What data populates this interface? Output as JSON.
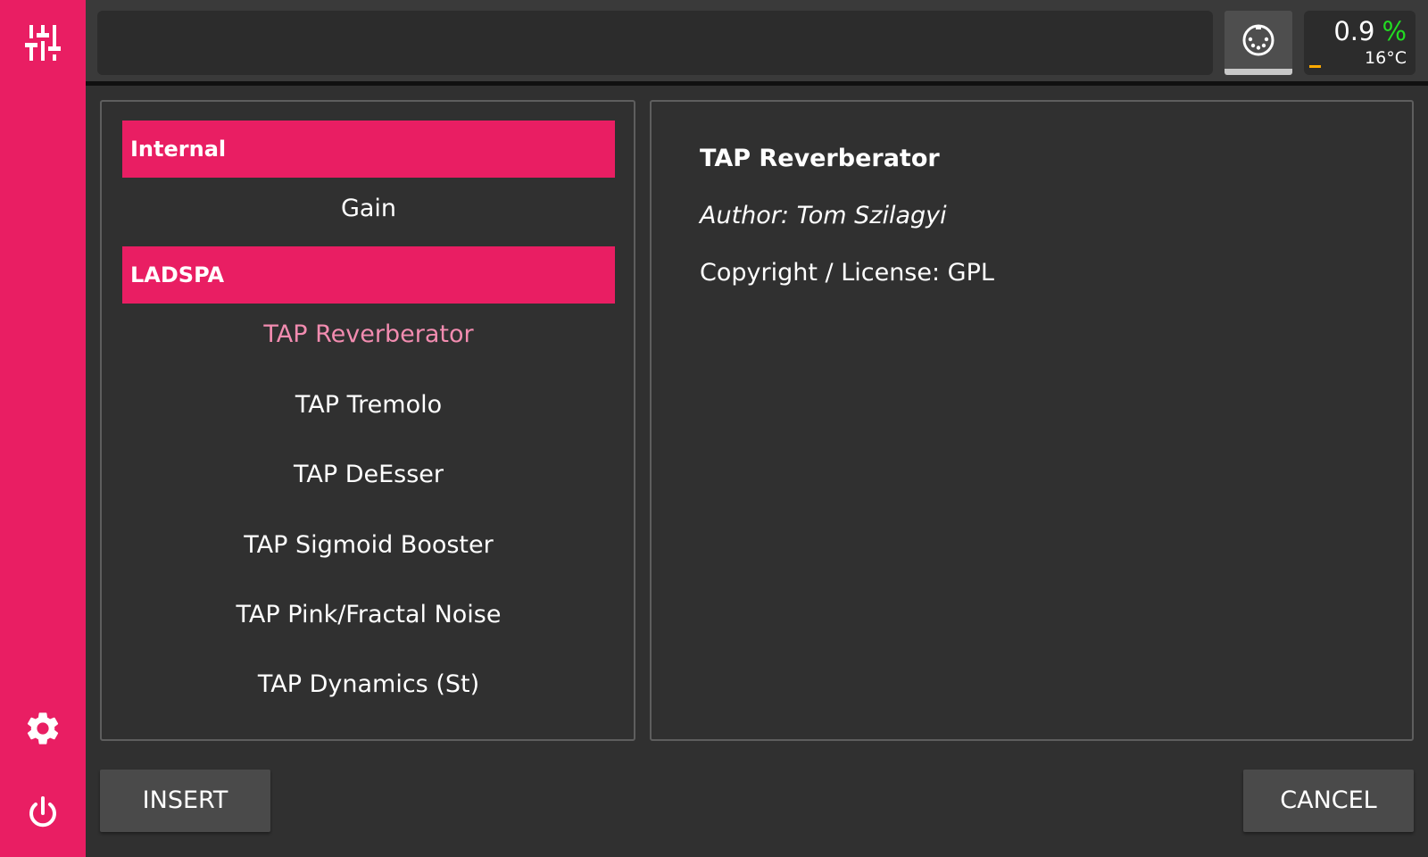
{
  "colors": {
    "accent": "#e91e63",
    "background": "#303030",
    "selected_text": "#f28cb0",
    "cpu_unit": "#22dd22",
    "meter": "#ffaa00"
  },
  "sidebar": {
    "icons": [
      "mixer-icon",
      "gear-icon",
      "power-icon"
    ]
  },
  "topbar": {
    "title": "",
    "midi_icon": "midi-connector-icon",
    "cpu_value": "0.9",
    "cpu_unit": "%",
    "temperature": "16°C"
  },
  "plugin_list": {
    "categories": [
      {
        "label": "Internal",
        "items": [
          "Gain"
        ]
      },
      {
        "label": "LADSPA",
        "items": [
          "TAP Reverberator",
          "TAP Tremolo",
          "TAP DeEsser",
          "TAP Sigmoid Booster",
          "TAP Pink/Fractal Noise",
          "TAP Dynamics (St)"
        ]
      }
    ],
    "selected": "TAP Reverberator"
  },
  "details": {
    "title": "TAP Reverberator",
    "author": "Author: Tom Szilagyi",
    "license": "Copyright / License: GPL"
  },
  "buttons": {
    "insert": "INSERT",
    "cancel": "CANCEL"
  }
}
